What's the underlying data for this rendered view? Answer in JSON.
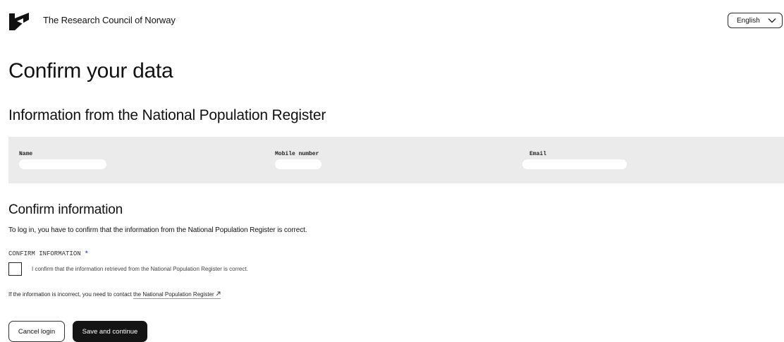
{
  "header": {
    "org_name": "The Research Council of Norway",
    "language": {
      "selected": "English"
    }
  },
  "page_title": "Confirm your data",
  "register": {
    "title": "Information from the National Population Register",
    "fields": {
      "name_label": "Name",
      "mobile_label": "Mobile number",
      "email_label": "Email"
    }
  },
  "confirm": {
    "title": "Confirm information",
    "intro": "To log in, you have to confirm that the information from the National Population Register is correct.",
    "checkbox_group_label": "CONFIRM INFORMATION",
    "required_mark": "*",
    "checkbox_label": "I confirm that the information retrieved from the National Population Register is correct.",
    "checkbox_checked": false,
    "contact_prefix": "If the information is incorrect, you need to contact ",
    "contact_link": "the National Population Register",
    "contact_link_icon": "arrow-up-right-icon"
  },
  "buttons": {
    "cancel": "Cancel login",
    "save": "Save and continue"
  },
  "colors": {
    "panel_bg": "#ebebeb",
    "primary_button": "#141414",
    "required_accent": "#1d5fd6"
  },
  "icons": {
    "logo": "research-council-logo-icon",
    "language_dropdown": "chevron-down-icon"
  }
}
